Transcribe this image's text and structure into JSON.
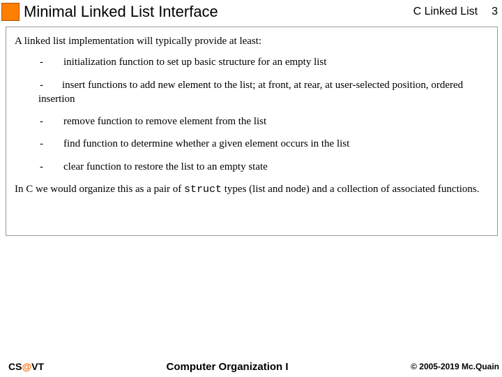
{
  "header": {
    "title": "Minimal Linked List Interface",
    "subject": "C Linked List",
    "page_number": "3"
  },
  "body": {
    "intro": "A linked list implementation will typically provide at least:",
    "bullets": [
      "initialization function to set up basic structure for an empty list",
      "insert functions to add new element to the list; at front, at rear, at user-selected position, ordered insertion",
      "remove function to remove element from the list",
      "find function to determine whether a given element occurs in the list",
      "clear function to restore the list to an empty state"
    ],
    "closing_pre": "In C we would organize this as a pair of ",
    "closing_code": "struct",
    "closing_post": " types (list and node) and a collection of associated functions."
  },
  "footer": {
    "left_pre": "CS",
    "left_at": "@",
    "left_post": "VT",
    "center": "Computer Organization I",
    "right": "© 2005-2019 Mc.Quain"
  },
  "colors": {
    "accent_orange": "#ff8000"
  }
}
